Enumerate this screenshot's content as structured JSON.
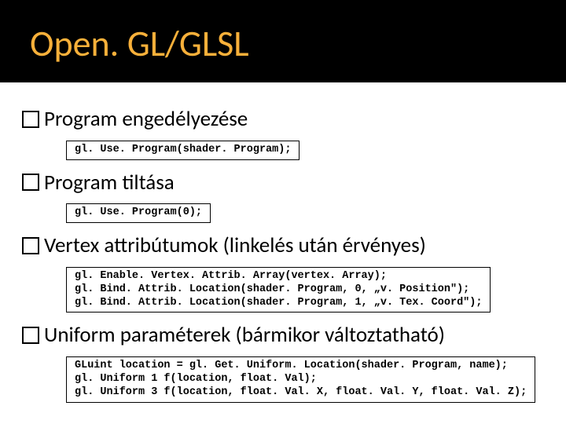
{
  "title": "Open. GL/GLSL",
  "bullets": [
    {
      "text": "Program engedélyezése",
      "code": "gl. Use. Program(shader. Program);"
    },
    {
      "text": "Program tiltása",
      "code": "gl. Use. Program(0);"
    },
    {
      "text": "Vertex attribútumok (linkelés után érvényes)",
      "code": "gl. Enable. Vertex. Attrib. Array(vertex. Array);\ngl. Bind. Attrib. Location(shader. Program, 0, „v. Position\");\ngl. Bind. Attrib. Location(shader. Program, 1, „v. Tex. Coord\");"
    },
    {
      "text": "Uniform paraméterek (bármikor változtatható)",
      "code": "GLuint location = gl. Get. Uniform. Location(shader. Program, name);\ngl. Uniform 1 f(location, float. Val);\ngl. Uniform 3 f(location, float. Val. X, float. Val. Y, float. Val. Z);"
    }
  ]
}
